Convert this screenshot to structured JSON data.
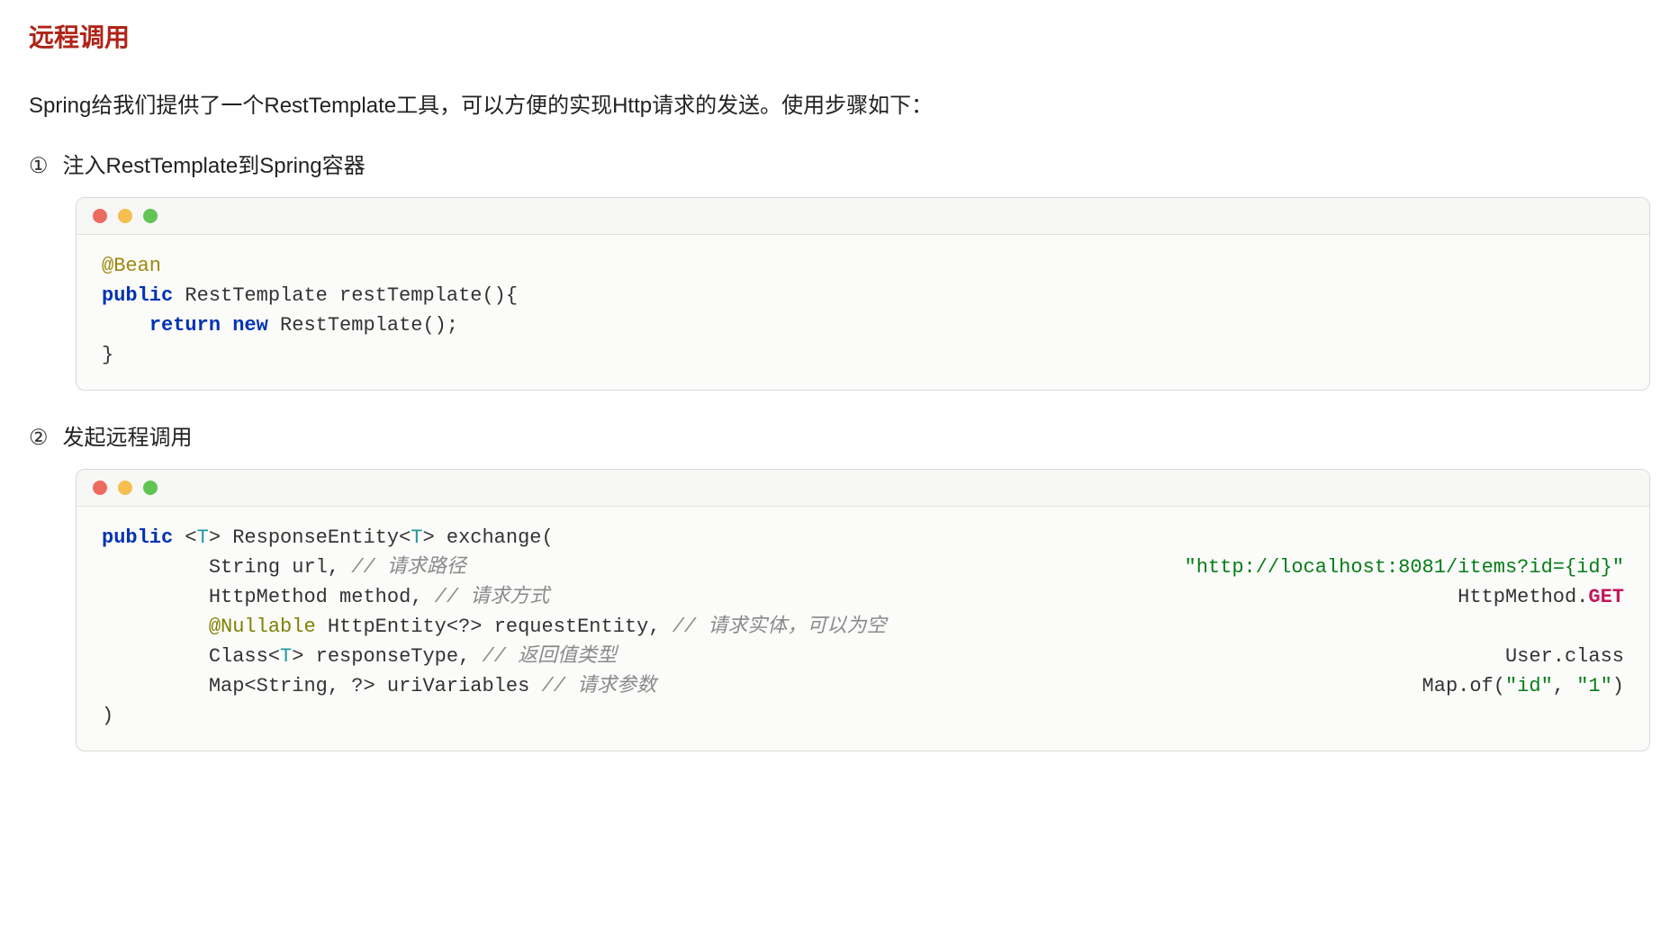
{
  "title": "远程调用",
  "description": "Spring给我们提供了一个RestTemplate工具，可以方便的实现Http请求的发送。使用步骤如下：",
  "steps": [
    {
      "number": "①",
      "text": "注入RestTemplate到Spring容器"
    },
    {
      "number": "②",
      "text": "发起远程调用"
    }
  ],
  "code1": {
    "annotation": "@Bean",
    "kw_public": "public",
    "sig": " RestTemplate restTemplate(){",
    "kw_return": "return",
    "kw_new": "new",
    "ret_rest": " RestTemplate();",
    "close": "}"
  },
  "code2": {
    "kw_public": "public",
    "generic_open": " <",
    "t": "T",
    "sig1": "> ResponseEntity<",
    "sig1b": "> exchange(",
    "indent": "         ",
    "line_url": "String url, ",
    "comment_url": "// 请求路径",
    "val_url": "\"http://localhost:8081/items?id={id}\"",
    "line_method": "HttpMethod method, ",
    "comment_method": "// 请求方式",
    "val_method_a": "HttpMethod.",
    "val_method_b": "GET",
    "nullable": "@Nullable",
    "line_entity": " HttpEntity<?> requestEntity, ",
    "comment_entity": "// 请求实体，可以为空",
    "line_class_a": "Class<",
    "line_class_b": "> responseType, ",
    "comment_class": "// 返回值类型",
    "val_class": "User.class",
    "line_map": "Map<String, ?> uriVariables ",
    "comment_map": "// 请求参数",
    "val_map_a": "Map.of(",
    "val_map_b": "\"id\"",
    "val_map_c": ", ",
    "val_map_d": "\"1\"",
    "val_map_e": ")",
    "close": ")"
  }
}
